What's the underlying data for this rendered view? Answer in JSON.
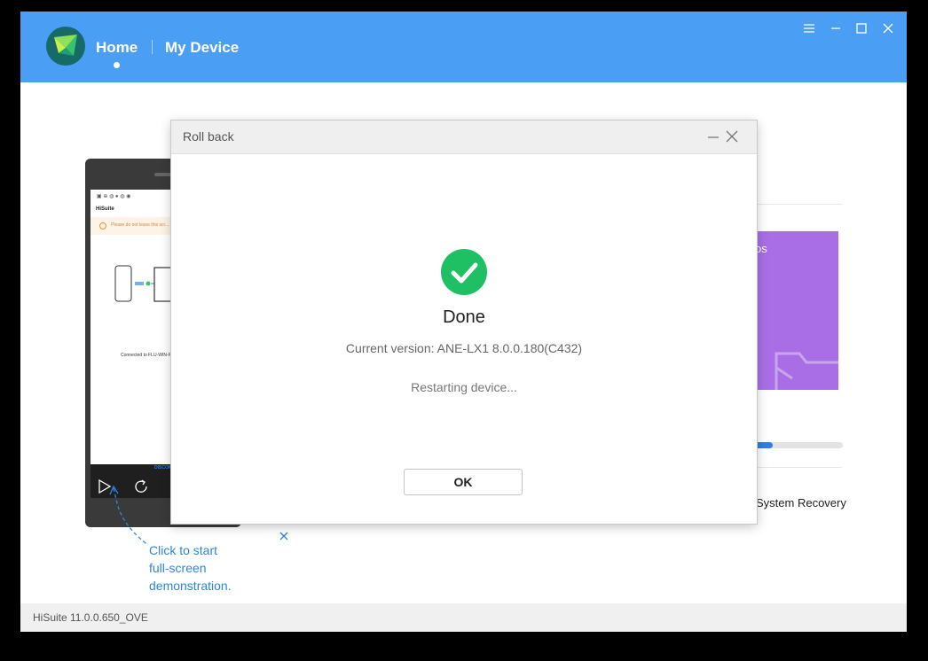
{
  "header": {
    "nav": {
      "home_label": "Home",
      "device_label": "My Device"
    },
    "accent_color": "#4a9ff5"
  },
  "phone_preview": {
    "app_title": "HiSuite",
    "warning_text": "Please do not leave this scr...",
    "connected_text": "Connected to FLU-WIN-P...",
    "disconnect_label": "DISCONNECT"
  },
  "right_panel": {
    "card_text": "os",
    "card_color": "#a96ee5",
    "progress_fraction": 0.2,
    "system_recovery_label": "System Recovery"
  },
  "hint": {
    "line1": "Click to start",
    "line2": "full-screen",
    "line3": "demonstration."
  },
  "dialog": {
    "title": "Roll back",
    "status": "Done",
    "version_text": "Current version: ANE-LX1 8.0.0.180(C432)",
    "progress_text": "Restarting device...",
    "ok_label": "OK",
    "success_color": "#1fbf63"
  },
  "footer": {
    "version": "HiSuite 11.0.0.650_OVE"
  }
}
